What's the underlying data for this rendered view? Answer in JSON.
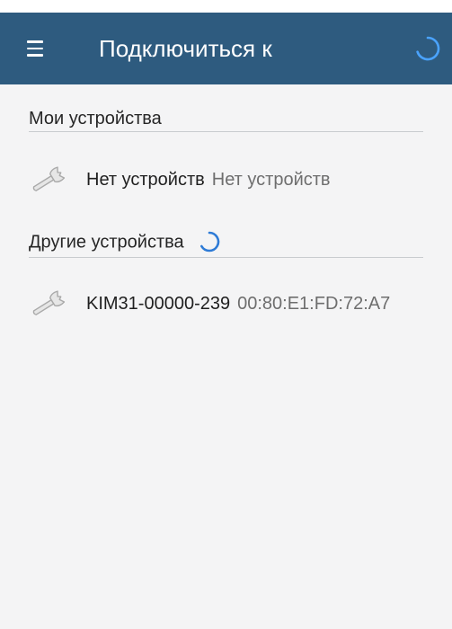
{
  "appbar": {
    "title": "Подключиться к",
    "menu_icon": "hamburger-menu-icon",
    "loading_icon": "loading-spinner-icon",
    "background": "#2e5b7f"
  },
  "my_devices": {
    "header": "Мои устройства",
    "items": [
      {
        "name": "Нет устройств",
        "detail": "Нет устройств",
        "icon": "wrench-icon"
      }
    ]
  },
  "other_devices": {
    "header": "Другие устройства",
    "loading_icon": "loading-spinner-icon",
    "items": [
      {
        "name": "KIM31-00000-239",
        "detail": "00:80:E1:FD:72:A7",
        "icon": "wrench-icon"
      }
    ]
  },
  "colors": {
    "accent": "#2e7bd6",
    "text_primary": "#1f1f1f",
    "text_secondary": "#6e6e6e",
    "divider": "#c9cccf"
  }
}
